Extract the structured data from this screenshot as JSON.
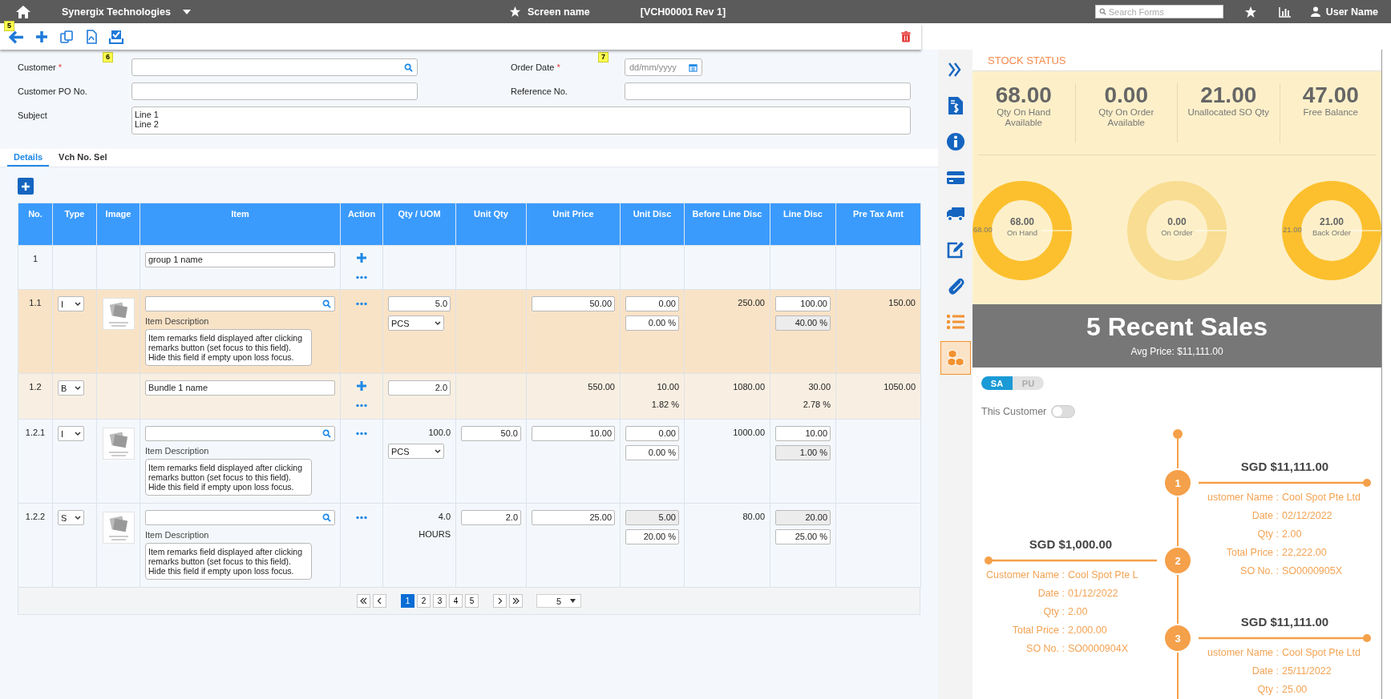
{
  "top_bar": {
    "company": "Synergix Technologies",
    "screen_name": "Screen name",
    "voucher": "[VCH00001 Rev 1]",
    "search": {
      "placeholder": "Search Forms"
    },
    "user_name": "User Name"
  },
  "toolbar": {
    "items": [
      {
        "kind": "back",
        "badge": "5"
      },
      {
        "kind": "add"
      },
      {
        "kind": "copy"
      },
      {
        "kind": "pdf"
      },
      {
        "kind": "save"
      }
    ],
    "delete": {
      "kind": "delete"
    }
  },
  "form": {
    "fields": [
      {
        "label": "Customer",
        "required_mark": "*",
        "kind": "search",
        "badge": "6"
      },
      {
        "label": "Order Date",
        "required_mark": "*",
        "kind": "date",
        "placeholder": "dd/mm/yyyy",
        "badge": "7"
      },
      {
        "label": "Customer PO No.",
        "kind": "text"
      },
      {
        "label": "Reference No.",
        "kind": "text"
      },
      {
        "label": "Subject",
        "kind": "textarea",
        "value": "Line 1\nLine 2"
      }
    ]
  },
  "tabs": [
    {
      "label": "Details",
      "selected": true
    },
    {
      "label": "Vch No. Sel",
      "selected": false
    }
  ],
  "table": {
    "columns": [
      "No.",
      "Type",
      "Image",
      "Item",
      "Action",
      "Qty / UOM",
      "Unit Qty",
      "Unit Price",
      "Unit Disc",
      "Before Line Disc",
      "Line Disc",
      "Pre Tax Amt"
    ],
    "rows": [
      {
        "kind": "group",
        "cells": [
          [
            {
              "kind": "text",
              "value": "1"
            }
          ],
          null,
          null,
          [
            {
              "kind": "input",
              "value": "group 1 name"
            }
          ],
          [
            {
              "kind": "plus"
            },
            {
              "kind": "more"
            }
          ],
          null,
          null,
          null,
          null,
          null,
          null,
          null
        ]
      },
      {
        "kind": "item",
        "cells": [
          [
            {
              "kind": "text",
              "value": "1.1"
            }
          ],
          [
            {
              "kind": "select",
              "value": "I"
            }
          ],
          [
            {
              "kind": "image"
            }
          ],
          [
            {
              "kind": "search"
            },
            {
              "kind": "caption",
              "value": "Item Description"
            },
            {
              "kind": "textarea",
              "value": "Item remarks field displayed after clicking\nremarks button (set focus to this field).\nHide this field if empty upon loss focus."
            }
          ],
          [
            {
              "kind": "more"
            }
          ],
          [
            {
              "kind": "input",
              "value": "5.0"
            },
            {
              "kind": "select",
              "value": "PCS"
            }
          ],
          null,
          [
            {
              "kind": "input",
              "value": "50.00"
            }
          ],
          [
            {
              "kind": "input",
              "value": "0.00"
            },
            {
              "kind": "input",
              "value": "0.00 %"
            }
          ],
          [
            {
              "kind": "text",
              "value": "250.00"
            }
          ],
          [
            {
              "kind": "input",
              "value": "100.00"
            },
            {
              "kind": "input",
              "value": "40.00 %",
              "readonly": true
            }
          ],
          [
            {
              "kind": "text",
              "value": "150.00"
            }
          ]
        ]
      },
      {
        "kind": "bundle",
        "cells": [
          [
            {
              "kind": "text",
              "value": "1.2"
            }
          ],
          [
            {
              "kind": "select",
              "value": "B"
            }
          ],
          null,
          [
            {
              "kind": "input",
              "value": "Bundle 1 name"
            }
          ],
          [
            {
              "kind": "plus"
            },
            {
              "kind": "more"
            }
          ],
          [
            {
              "kind": "input",
              "value": "2.0"
            }
          ],
          null,
          [
            {
              "kind": "text",
              "value": "550.00"
            }
          ],
          [
            {
              "kind": "text",
              "value": "10.00"
            },
            {
              "kind": "text",
              "value": "1.82 %"
            }
          ],
          [
            {
              "kind": "text",
              "value": "1080.00"
            }
          ],
          [
            {
              "kind": "text",
              "value": "30.00"
            },
            {
              "kind": "text",
              "value": "2.78 %"
            }
          ],
          [
            {
              "kind": "text",
              "value": "1050.00"
            }
          ]
        ]
      },
      {
        "kind": "child",
        "cells": [
          [
            {
              "kind": "text",
              "value": "1.2.1"
            }
          ],
          [
            {
              "kind": "select",
              "value": "I"
            }
          ],
          [
            {
              "kind": "image"
            }
          ],
          [
            {
              "kind": "search"
            },
            {
              "kind": "caption",
              "value": "Item Description"
            },
            {
              "kind": "textarea",
              "value": "Item remarks field displayed after clicking\nremarks button (set focus to this field).\nHide this field if empty upon loss focus."
            }
          ],
          [
            {
              "kind": "more"
            }
          ],
          [
            {
              "kind": "text",
              "value": "100.0"
            },
            {
              "kind": "select",
              "value": "PCS"
            }
          ],
          [
            {
              "kind": "input",
              "value": "50.0"
            }
          ],
          [
            {
              "kind": "input",
              "value": "10.00"
            }
          ],
          [
            {
              "kind": "input",
              "value": "0.00"
            },
            {
              "kind": "input",
              "value": "0.00 %"
            }
          ],
          [
            {
              "kind": "text",
              "value": "1000.00"
            }
          ],
          [
            {
              "kind": "input",
              "value": "10.00"
            },
            {
              "kind": "input",
              "value": "1.00 %",
              "readonly": true
            }
          ],
          null
        ]
      },
      {
        "kind": "child",
        "cells": [
          [
            {
              "kind": "text",
              "value": "1.2.2"
            }
          ],
          [
            {
              "kind": "select",
              "value": "S"
            }
          ],
          [
            {
              "kind": "image"
            }
          ],
          [
            {
              "kind": "search"
            },
            {
              "kind": "caption",
              "value": "Item Description"
            },
            {
              "kind": "textarea",
              "value": "Item remarks field displayed after clicking\nremarks button (set focus to this field).\nHide this field if empty upon loss focus."
            }
          ],
          [
            {
              "kind": "more"
            }
          ],
          [
            {
              "kind": "text",
              "value": "4.0"
            },
            {
              "kind": "text",
              "value": "HOURS"
            }
          ],
          [
            {
              "kind": "input",
              "value": "2.0"
            }
          ],
          [
            {
              "kind": "input",
              "value": "25.00"
            }
          ],
          [
            {
              "kind": "input",
              "value": "5.00",
              "readonly": true
            },
            {
              "kind": "input",
              "value": "20.00 %"
            }
          ],
          [
            {
              "kind": "text",
              "value": "80.00"
            }
          ],
          [
            {
              "kind": "input",
              "value": "20.00",
              "readonly": true
            },
            {
              "kind": "input",
              "value": "25.00 %"
            }
          ],
          null
        ]
      }
    ]
  },
  "pager": {
    "pages": [
      {
        "label": "1",
        "selected": true
      },
      {
        "label": "2",
        "selected": false
      },
      {
        "label": "3",
        "selected": false
      },
      {
        "label": "4",
        "selected": false
      },
      {
        "label": "5",
        "selected": false
      }
    ],
    "page_size": "5"
  },
  "sidebar": {
    "items": [
      {
        "kind": "collapse",
        "selected": false,
        "color": "#1565c0"
      },
      {
        "kind": "invoice",
        "selected": false,
        "color": "#1565c0"
      },
      {
        "kind": "info",
        "selected": false,
        "color": "#1565c0"
      },
      {
        "kind": "card",
        "selected": false,
        "color": "#1565c0"
      },
      {
        "kind": "truck",
        "selected": false,
        "color": "#1565c0"
      },
      {
        "kind": "edit",
        "selected": false,
        "color": "#1565c0"
      },
      {
        "kind": "attach",
        "selected": false,
        "color": "#1565c0"
      },
      {
        "kind": "list",
        "selected": false,
        "color": "#f39230"
      },
      {
        "kind": "stock",
        "selected": true,
        "color": "#f39230"
      }
    ]
  },
  "stock_status": {
    "title": "STOCK STATUS",
    "stats": [
      {
        "value": "68.00",
        "label": "Qty On Hand\nAvailable"
      },
      {
        "value": "0.00",
        "label": "Qty On Order\nAvailable"
      },
      {
        "value": "21.00",
        "label": "Unallocated SO Qty"
      },
      {
        "value": "47.00",
        "label": "Free Balance"
      }
    ],
    "donuts": [
      {
        "value": "68.00",
        "label": "On Hand",
        "side_label": "68.00",
        "color": "#fcc02e"
      },
      {
        "value": "0.00",
        "label": "On Order",
        "color": "#f8dd92"
      },
      {
        "value": "21.00",
        "label": "Back Order",
        "side_label": "21.00",
        "color": "#fcc02e"
      }
    ]
  },
  "recent_sales": {
    "title": "5 Recent Sales",
    "avg_price": "Avg Price: $11,111.00",
    "segments": [
      {
        "label": "SA",
        "selected": true
      },
      {
        "label": "PU",
        "selected": false
      }
    ],
    "this_customer": {
      "label": "This Customer",
      "on": false
    },
    "entries": [
      {
        "number": "1",
        "title": "SGD $11,111.00",
        "details": [
          {
            "label": "ustomer Name :",
            "value": "Cool Spot Pte Ltd"
          },
          {
            "label": "Date :",
            "value": "02/12/2022"
          },
          {
            "label": "Qty :",
            "value": "2.00"
          },
          {
            "label": "Total Price :",
            "value": "22,222.00"
          },
          {
            "label": "SO No. :",
            "value": "SO0000905X"
          }
        ]
      },
      {
        "number": "2",
        "title": "SGD $1,000.00",
        "details": [
          {
            "label": "Customer Name :",
            "value": "Cool Spot Pte L"
          },
          {
            "label": "Date :",
            "value": "01/12/2022"
          },
          {
            "label": "Qty :",
            "value": "2.00"
          },
          {
            "label": "Total Price :",
            "value": "2,000.00"
          },
          {
            "label": "SO No. :",
            "value": "SO0000904X"
          }
        ]
      },
      {
        "number": "3",
        "title": "SGD $11,111.00",
        "details": [
          {
            "label": "ustomer Name :",
            "value": "Cool Spot Pte Ltd"
          },
          {
            "label": "Date :",
            "value": "25/11/2022"
          },
          {
            "label": "Qty :",
            "value": "25.00"
          }
        ]
      }
    ]
  }
}
